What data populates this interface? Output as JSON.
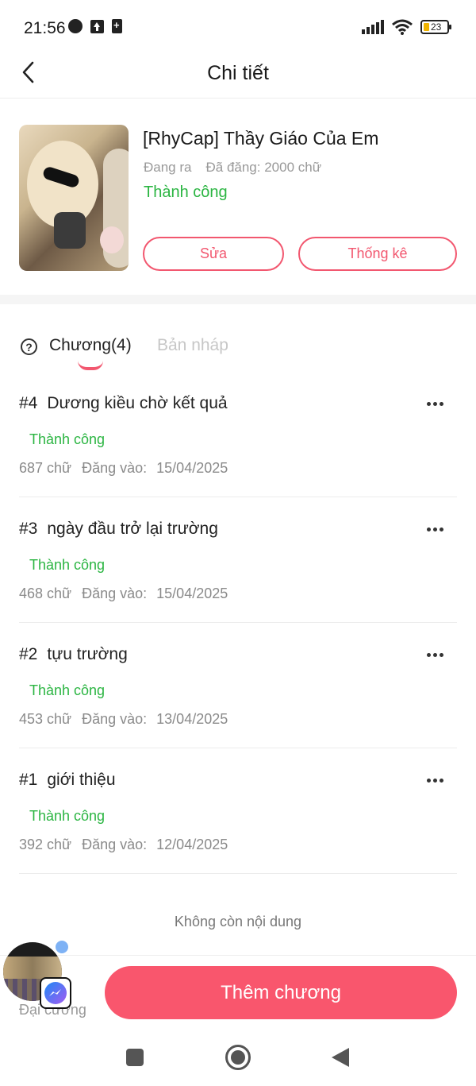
{
  "status_bar": {
    "time": "21:56",
    "battery": "23",
    "icons_left": [
      "messenger-icon",
      "upload-icon",
      "battery-saver-icon"
    ],
    "icons_right": [
      "signal-icon",
      "wifi-icon",
      "battery-icon"
    ]
  },
  "header": {
    "title": "Chi tiết",
    "back_icon": "chevron-left-icon"
  },
  "story": {
    "title": "[RhyCap] Thầy Giáo Của Em",
    "state": "Đang ra",
    "posted": "Đã đăng: 2000 chữ",
    "status": "Thành công",
    "edit_label": "Sửa",
    "stats_label": "Thống kê"
  },
  "tabs": {
    "help_icon": "question-circle-icon",
    "chapters_label": "Chương(4)",
    "drafts_label": "Bản nháp"
  },
  "chapters": [
    {
      "num": "#4",
      "title": "Dương kiều chờ kết quả",
      "status": "Thành công",
      "words": "687 chữ",
      "posted_label": "Đăng vào:",
      "date": "15/04/2025"
    },
    {
      "num": "#3",
      "title": "ngày đầu trở lại trường",
      "status": "Thành công",
      "words": "468 chữ",
      "posted_label": "Đăng vào:",
      "date": "15/04/2025"
    },
    {
      "num": "#2",
      "title": "tựu trường",
      "status": "Thành công",
      "words": "453 chữ",
      "posted_label": "Đăng vào:",
      "date": "13/04/2025"
    },
    {
      "num": "#1",
      "title": "giới thiệu",
      "status": "Thành công",
      "words": "392 chữ",
      "posted_label": "Đăng vào:",
      "date": "12/04/2025"
    }
  ],
  "list_end": "Không còn nội dung",
  "bottom": {
    "outline_label": "Đại cương",
    "add_chapter_label": "Thêm chương"
  },
  "colors": {
    "accent": "#f9566d",
    "success": "#2bb542",
    "muted": "#999999"
  }
}
